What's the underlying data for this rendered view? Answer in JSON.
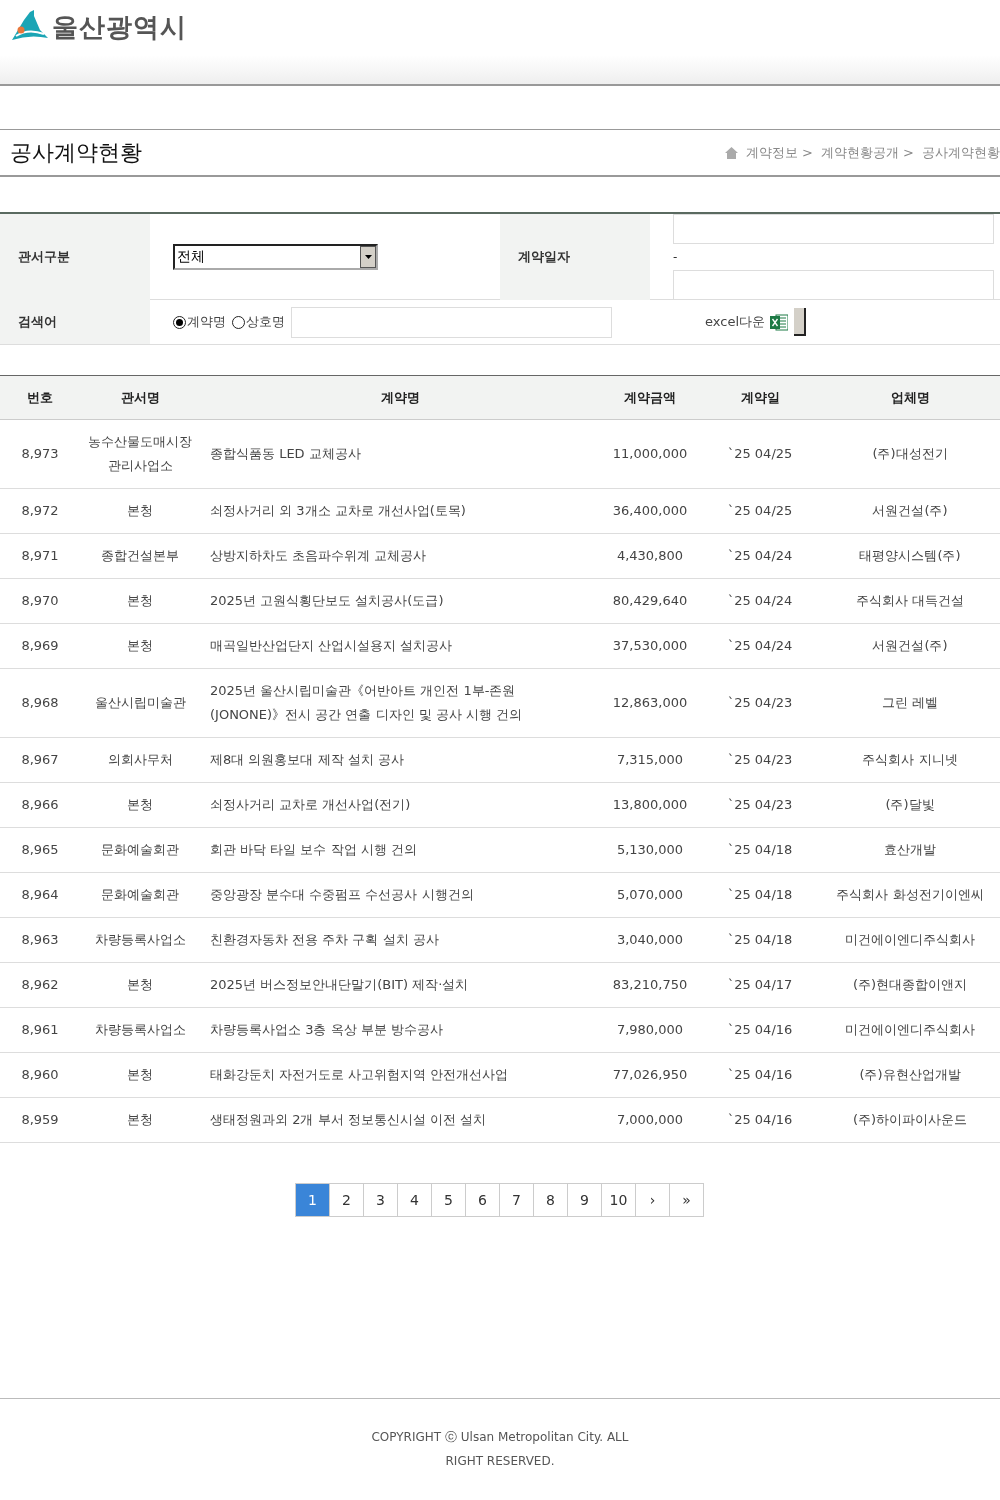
{
  "header": {
    "logo_text": "울산광역시"
  },
  "page": {
    "title": "공사계약현황",
    "breadcrumb": [
      "계약정보 >",
      "계약현황공개 >",
      "공사계약현황"
    ]
  },
  "search": {
    "office_label": "관서구분",
    "office_value": "전체",
    "date_label": "계약일자",
    "date_separator": "-",
    "keyword_label": "검색어",
    "radios": [
      {
        "label": "계약명",
        "selected": true
      },
      {
        "label": "상호명",
        "selected": false
      }
    ],
    "excel_label": "excel다운"
  },
  "table": {
    "columns": [
      "번호",
      "관서명",
      "계약명",
      "계약금액",
      "계약일",
      "업체명"
    ],
    "rows": [
      [
        "8,973",
        "농수산물도매시장 관리사업소",
        "종합식품동 LED 교체공사",
        "11,000,000",
        "`25 04/25",
        "(주)대성전기"
      ],
      [
        "8,972",
        "본청",
        "쇠정사거리 외 3개소 교차로 개선사업(토목)",
        "36,400,000",
        "`25 04/25",
        "서원건설(주)"
      ],
      [
        "8,971",
        "종합건설본부",
        "상방지하차도 초음파수위계 교체공사",
        "4,430,800",
        "`25 04/24",
        "태평양시스템(주)"
      ],
      [
        "8,970",
        "본청",
        "2025년 고원식횡단보도 설치공사(도급)",
        "80,429,640",
        "`25 04/24",
        "주식회사 대득건설"
      ],
      [
        "8,969",
        "본청",
        "매곡일반산업단지 산업시설용지 설치공사",
        "37,530,000",
        "`25 04/24",
        "서원건설(주)"
      ],
      [
        "8,968",
        "울산시립미술관",
        "2025년 울산시립미술관《어반아트 개인전 1부-존원(JONONE)》전시 공간 연출 디자인 및 공사 시행 건의",
        "12,863,000",
        "`25 04/23",
        "그린 레벨"
      ],
      [
        "8,967",
        "의회사무처",
        "제8대 의원홍보대 제작 설치 공사",
        "7,315,000",
        "`25 04/23",
        "주식회사 지니넷"
      ],
      [
        "8,966",
        "본청",
        "쇠정사거리 교차로 개선사업(전기)",
        "13,800,000",
        "`25 04/23",
        "(주)달빛"
      ],
      [
        "8,965",
        "문화예술회관",
        "회관 바닥 타일 보수 작업 시행 건의",
        "5,130,000",
        "`25 04/18",
        "효산개발"
      ],
      [
        "8,964",
        "문화예술회관",
        "중앙광장 분수대 수중펌프 수선공사 시행건의",
        "5,070,000",
        "`25 04/18",
        "주식회사 화성전기이엔씨"
      ],
      [
        "8,963",
        "차량등록사업소",
        "친환경자동차 전용 주차 구획 설치 공사",
        "3,040,000",
        "`25 04/18",
        "미건에이엔디주식회사"
      ],
      [
        "8,962",
        "본청",
        "2025년 버스정보안내단말기(BIT) 제작·설치",
        "83,210,750",
        "`25 04/17",
        "(주)현대종합이앤지"
      ],
      [
        "8,961",
        "차량등록사업소",
        "차량등록사업소 3층 옥상 부분 방수공사",
        "7,980,000",
        "`25 04/16",
        "미건에이엔디주식회사"
      ],
      [
        "8,960",
        "본청",
        "태화강둔치 자전거도로 사고위험지역 안전개선사업",
        "77,026,950",
        "`25 04/16",
        "(주)유현산업개발"
      ],
      [
        "8,959",
        "본청",
        "생태정원과외 2개 부서 정보통신시설 이전 설치",
        "7,000,000",
        "`25 04/16",
        "(주)하이파이사운드"
      ]
    ]
  },
  "pagination": [
    {
      "label": "1",
      "selected": true
    },
    {
      "label": "2",
      "selected": false
    },
    {
      "label": "3",
      "selected": false
    },
    {
      "label": "4",
      "selected": false
    },
    {
      "label": "5",
      "selected": false
    },
    {
      "label": "6",
      "selected": false
    },
    {
      "label": "7",
      "selected": false
    },
    {
      "label": "8",
      "selected": false
    },
    {
      "label": "9",
      "selected": false
    },
    {
      "label": "10",
      "selected": false
    },
    {
      "label": "›",
      "selected": false
    },
    {
      "label": "»",
      "selected": false
    }
  ],
  "footer": {
    "copyright": "COPYRIGHT ⓒ Ulsan Metropolitan City. ALL RIGHT RESERVED."
  }
}
